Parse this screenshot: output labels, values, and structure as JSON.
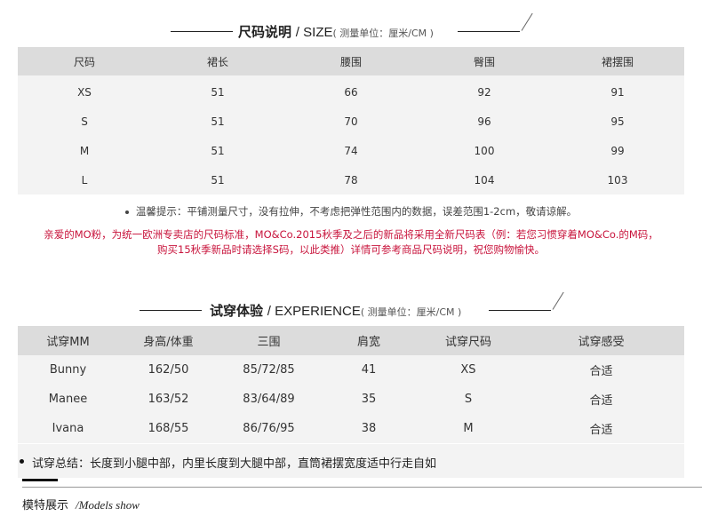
{
  "size_section": {
    "title_cn": "尺码说明",
    "title_en": "SIZE",
    "unit": "( 测量单位：厘米/CM )",
    "headers": [
      "尺码",
      "裙长",
      "腰围",
      "臀围",
      "裙摆围"
    ],
    "rows": [
      [
        "XS",
        "51",
        "66",
        "92",
        "91"
      ],
      [
        "S",
        "51",
        "70",
        "96",
        "95"
      ],
      [
        "M",
        "51",
        "74",
        "100",
        "99"
      ],
      [
        "L",
        "51",
        "78",
        "104",
        "103"
      ]
    ],
    "tip": "温馨提示：平铺测量尺寸，没有拉伸，不考虑把弹性范围内的数据，误差范围1-2cm，敬请谅解。",
    "notice_line1": "亲爱的MO粉，为统一欧洲专卖店的尺码标准，MO&Co.2015秋季及之后的新品将采用全新尺码表（例：若您习惯穿着MO&Co.的M码，",
    "notice_line2": "购买15秋季新品时请选择S码，以此类推）详情可参考商品尺码说明，祝您购物愉快。",
    "accent_color": "#c8143c"
  },
  "experience_section": {
    "title_cn": "试穿体验",
    "title_en": "EXPERIENCE",
    "unit": "( 测量单位：厘米/CM )",
    "headers": [
      "试穿MM",
      "身高/体重",
      "三围",
      "肩宽",
      "试穿尺码",
      "试穿感受"
    ],
    "rows": [
      [
        "Bunny",
        "162/50",
        "85/72/85",
        "41",
        "XS",
        "合适"
      ],
      [
        "Manee",
        "163/52",
        "83/64/89",
        "35",
        "S",
        "合适"
      ],
      [
        "Ivana",
        "168/55",
        "86/76/95",
        "38",
        "M",
        "合适"
      ]
    ],
    "summary": "试穿总结：长度到小腿中部，内里长度到大腿中部，直筒裙摆宽度适中行走自如"
  },
  "models_section": {
    "title_cn": "模特展示",
    "title_en": "/Models show"
  }
}
